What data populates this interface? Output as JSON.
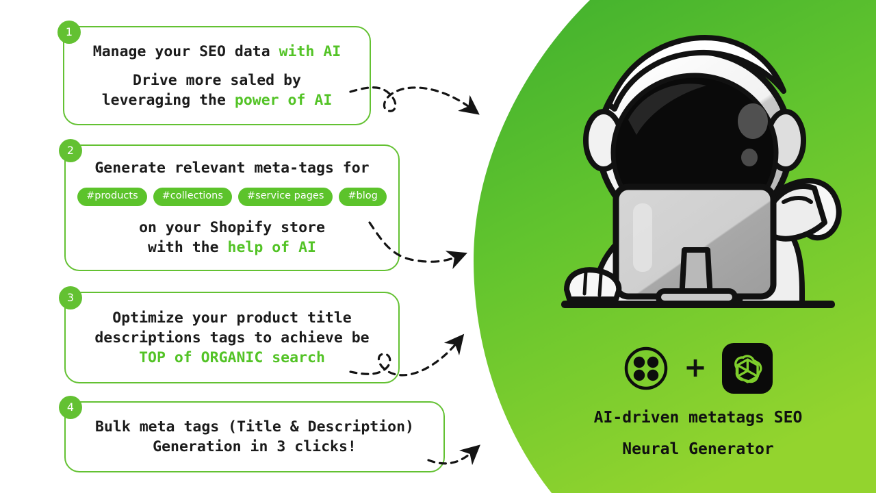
{
  "theme": {
    "accent_green": "#63c132",
    "text_green": "#53c326",
    "pill_green": "#5cc32b",
    "panel_green_top": "#46b42e",
    "panel_green_bottom": "#8ed12e",
    "text_dark": "#1b1b1b",
    "card_bg": "#ffffff",
    "page_bg": "#ffffff"
  },
  "cards": [
    {
      "badge": "1",
      "lines": [
        [
          {
            "text": "Manage your SEO data ",
            "accent": false
          },
          {
            "text": "with AI",
            "accent": true
          }
        ],
        [
          {
            "text": "Drive more saled by",
            "accent": false
          }
        ],
        [
          {
            "text": "leveraging the ",
            "accent": false
          },
          {
            "text": "power of AI",
            "accent": true
          }
        ]
      ],
      "tags": []
    },
    {
      "badge": "2",
      "lines": [
        [
          {
            "text": "Generate relevant meta-tags for",
            "accent": false
          }
        ]
      ],
      "tags": [
        "#products",
        "#collections",
        "#service pages",
        "#blog"
      ],
      "lines_after_tags": [
        [
          {
            "text": "on your Shopify store",
            "accent": false
          }
        ],
        [
          {
            "text": "with the ",
            "accent": false
          },
          {
            "text": "help of AI",
            "accent": true
          }
        ]
      ]
    },
    {
      "badge": "3",
      "lines": [
        [
          {
            "text": "Optimize your product title",
            "accent": false
          }
        ],
        [
          {
            "text": "descriptions tags to achieve be",
            "accent": false
          }
        ],
        [
          {
            "text": "TOP of ORGANIC search",
            "accent": true
          }
        ]
      ],
      "tags": []
    },
    {
      "badge": "4",
      "lines": [
        [
          {
            "text": "Bulk meta tags (Title & Description)",
            "accent": false
          }
        ],
        [
          {
            "text": "Generation in 3 clicks!",
            "accent": false
          }
        ]
      ],
      "tags": []
    }
  ],
  "brand": {
    "logo_left": "four-dots-logo",
    "plus": "+",
    "logo_right": "openai-logo",
    "title_line_1": "AI-driven metatags SEO",
    "title_line_2": "Neural Generator"
  },
  "illustration": {
    "name": "astronaut-at-computer",
    "description": "Cartoon astronaut with black visor helmet waving, sitting behind a computer monitor"
  },
  "connectors": [
    {
      "name": "arrow-card-1",
      "style": "dashed-curve-with-loop"
    },
    {
      "name": "arrow-card-2",
      "style": "dashed-curve"
    },
    {
      "name": "arrow-card-3",
      "style": "dashed-curve-with-loop"
    },
    {
      "name": "arrow-card-4",
      "style": "dashed-short-curve"
    }
  ]
}
